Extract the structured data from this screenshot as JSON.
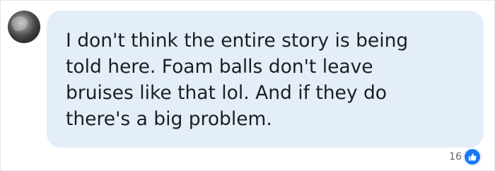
{
  "comment": {
    "text": "I don't think the entire story is being\ntold here. Foam balls don't leave\nbruises like that lol. And if they do\nthere's a big problem."
  },
  "reactions": {
    "count": "16",
    "icon": "like-icon",
    "color": "#1877f2"
  },
  "avatar": {
    "icon": "user-avatar"
  }
}
